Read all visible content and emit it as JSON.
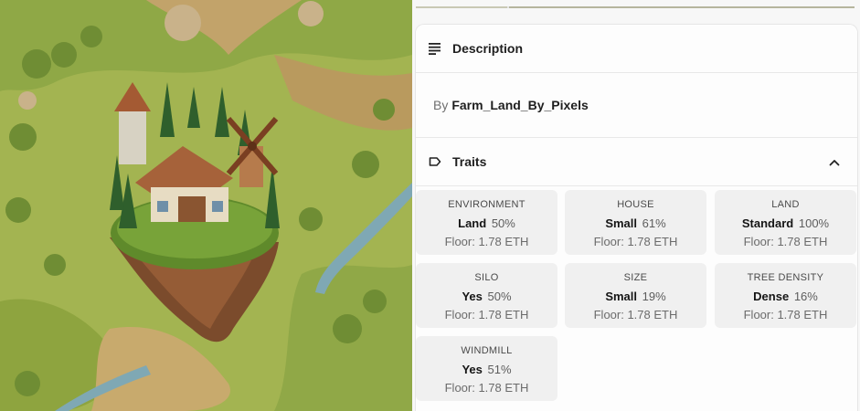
{
  "artwork": {
    "alt": ""
  },
  "description": {
    "title": "Description",
    "by_label": "By",
    "creator": "Farm_Land_By_Pixels"
  },
  "traits": {
    "title": "Traits",
    "items": [
      {
        "type": "ENVIRONMENT",
        "value": "Land",
        "percent": "50%",
        "floor": "Floor: 1.78 ETH"
      },
      {
        "type": "HOUSE",
        "value": "Small",
        "percent": "61%",
        "floor": "Floor: 1.78 ETH"
      },
      {
        "type": "LAND",
        "value": "Standard",
        "percent": "100%",
        "floor": "Floor: 1.78 ETH"
      },
      {
        "type": "SILO",
        "value": "Yes",
        "percent": "50%",
        "floor": "Floor: 1.78 ETH"
      },
      {
        "type": "SIZE",
        "value": "Small",
        "percent": "19%",
        "floor": "Floor: 1.78 ETH"
      },
      {
        "type": "TREE DENSITY",
        "value": "Dense",
        "percent": "16%",
        "floor": "Floor: 1.78 ETH"
      },
      {
        "type": "WINDMILL",
        "value": "Yes",
        "percent": "51%",
        "floor": "Floor: 1.78 ETH"
      }
    ]
  },
  "icons": {
    "description": "lines-icon",
    "traits": "tag-icon",
    "collapse": "chevron-up-icon"
  },
  "colors": {
    "card_bg": "#fdfdfd",
    "trait_bg": "#f0f0f0",
    "text": "#1f1f1f",
    "muted": "#6b6b6b"
  }
}
